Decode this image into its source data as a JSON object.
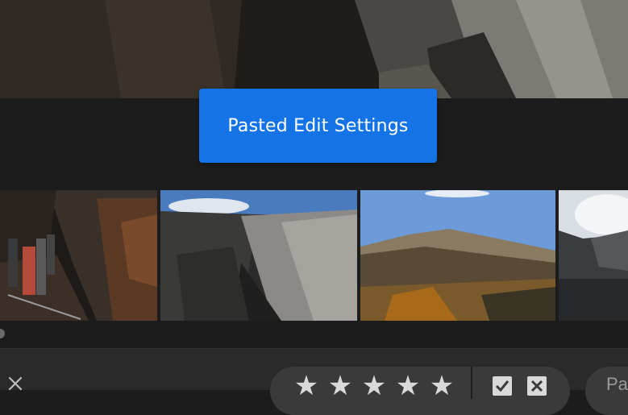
{
  "toast": {
    "message": "Pasted Edit Settings"
  },
  "filmstrip": {
    "items": [
      {
        "name": "hikers-canyon-overlook"
      },
      {
        "name": "painted-wall-canyon"
      },
      {
        "name": "autumn-mountain-ridge"
      },
      {
        "name": "mountain-clouds"
      }
    ]
  },
  "toolbar": {
    "close_icon": "close-icon",
    "rating": {
      "max": 5,
      "value": 5
    },
    "flags": [
      "pick-flag-icon",
      "reject-flag-icon"
    ],
    "next_label": "Pa"
  },
  "colors": {
    "toast": "#1473e6",
    "background": "#1c1c1c",
    "toolbar": "#2a2a2a"
  }
}
